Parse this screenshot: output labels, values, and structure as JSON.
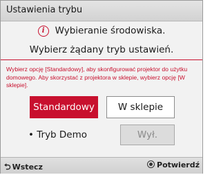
{
  "dialog": {
    "title": "Ustawienia trybu",
    "info_line1": "Wybieranie środowiska.",
    "info_line2": "Wybierz żądany tryb ustawień.",
    "description": "Wybierz opcję [Standardowy], aby skonfigurować projektor do użytku domowego. Aby skorzystać z projektora w sklepie, wybierz opcję [W sklepie].",
    "info_icon": "info-icon",
    "accent_color": "#c8102e"
  },
  "modes": {
    "standard_label": "Standardowy",
    "shop_label": "W sklepie",
    "selected": "Standardowy"
  },
  "demo": {
    "label": "• Tryb Demo",
    "value": "Wył."
  },
  "footer": {
    "back_label": "Wstecz",
    "back_icon": "return-arrow-icon",
    "confirm_label": "Potwierdź",
    "confirm_icon": "ok-button-icon"
  }
}
